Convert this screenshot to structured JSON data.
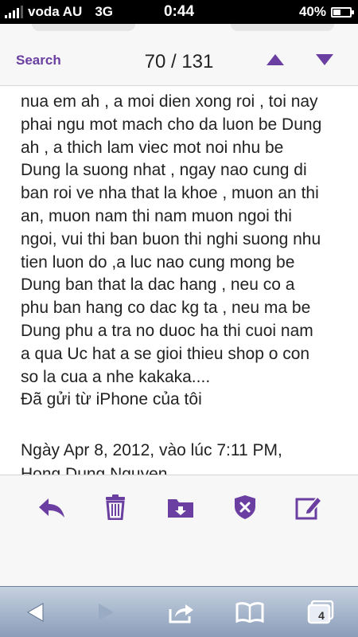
{
  "status_bar": {
    "carrier": "voda AU",
    "network": "3G",
    "time": "0:44",
    "battery": "40%"
  },
  "header": {
    "search_label": "Search",
    "counter": "70 / 131",
    "accent_color": "#6a3fa1"
  },
  "message": {
    "lines": "nua em ah , a moi dien xong roi , toi nay\nphai ngu mot mach cho da luon be Dung\nah , a thich lam viec mot noi nhu be\nDung la suong nhat , ngay nao cung di\nban roi ve nha that la khoe ,  muon an thi\nan, muon nam thi nam muon ngoi thi\nngoi, vui thi ban buon thi nghi suong nhu\ntien luon do ,a luc nao cung mong be\nDung ban that la dac hang , neu co a\nphu ban hang co dac kg ta , neu ma be\nDung phu a tra no duoc ha thi cuoi nam\na qua Uc hat a se gioi thieu shop o con\nso la cua a nhe kakaka....",
    "sent_from": "Đã gửi từ iPhone của tôi",
    "date_line": "Ngày Apr 8, 2012, vào lúc 7:11 PM,",
    "cut_line": "Hong Dung Nguyen"
  },
  "actions": {
    "icons": [
      "reply-icon",
      "trash-icon",
      "move-to-folder-icon",
      "spam-shield-icon",
      "compose-icon"
    ]
  },
  "safari_toolbar": {
    "icons": [
      "back-arrow-icon",
      "forward-arrow-icon",
      "share-icon",
      "bookmarks-icon",
      "tabs-icon"
    ],
    "tabs_count": "4"
  }
}
